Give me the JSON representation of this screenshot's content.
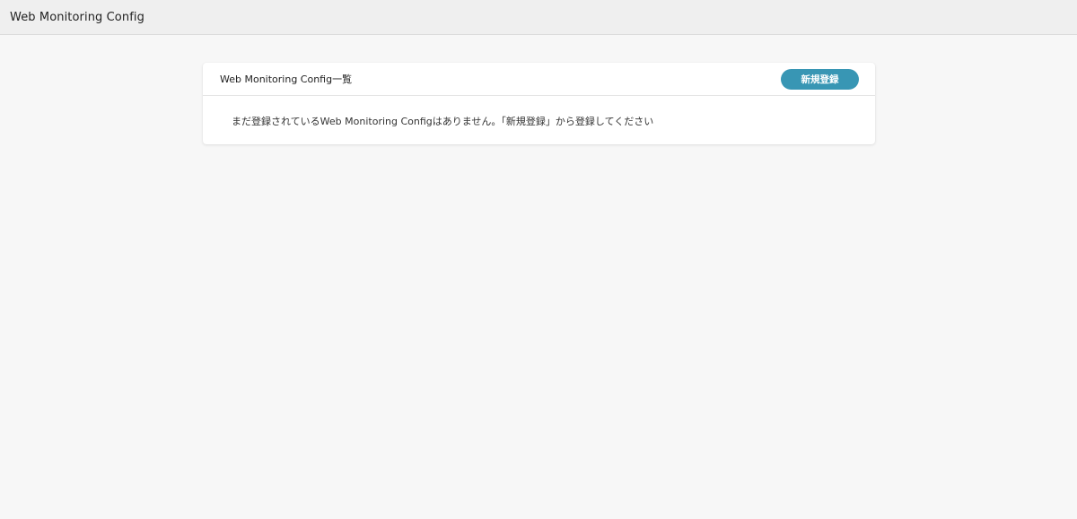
{
  "header": {
    "title": "Web Monitoring Config"
  },
  "list_card": {
    "title": "Web Monitoring Config一覧",
    "new_button_label": "新規登録",
    "empty_message": "まだ登録されているWeb Monitoring Configはありません。「新規登録」から登録してください"
  },
  "colors": {
    "accent": "#3896b4",
    "page_background": "#f7f7f7",
    "header_background": "#efefef"
  }
}
